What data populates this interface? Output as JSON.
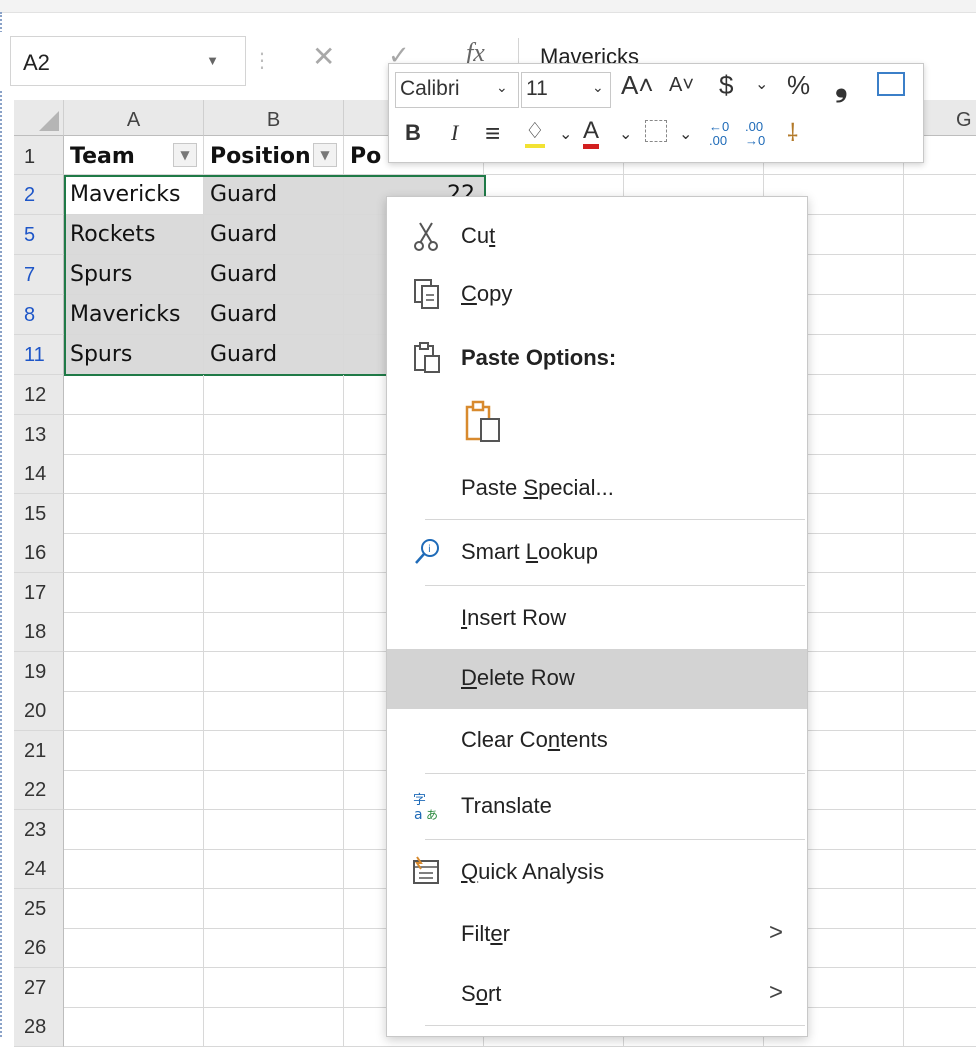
{
  "name_box": "A2",
  "formula": {
    "fx": "fx",
    "value": "Mavericks"
  },
  "columns": [
    "A",
    "B",
    "G"
  ],
  "header_row": {
    "num": "1",
    "team": "Team",
    "position": "Position",
    "points": "Po"
  },
  "data_rows": [
    {
      "num": "2",
      "team": "Mavericks",
      "position": "Guard",
      "points": "22"
    },
    {
      "num": "5",
      "team": "Rockets",
      "position": "Guard"
    },
    {
      "num": "7",
      "team": "Spurs",
      "position": "Guard"
    },
    {
      "num": "8",
      "team": "Mavericks",
      "position": "Guard"
    },
    {
      "num": "11",
      "team": "Spurs",
      "position": "Guard"
    }
  ],
  "empty_rows": [
    "12",
    "13",
    "14",
    "15",
    "16",
    "17",
    "18",
    "19",
    "20",
    "21",
    "22",
    "23",
    "24",
    "25",
    "26",
    "27",
    "28"
  ],
  "mini_toolbar": {
    "font": "Calibri",
    "size": "11",
    "bold": "B",
    "italic": "I",
    "currency": "$",
    "percent": "%"
  },
  "context_menu": {
    "cut": {
      "pre": "Cu",
      "key": "t",
      "post": ""
    },
    "copy": {
      "pre": "",
      "key": "C",
      "post": "opy"
    },
    "paste_options": "Paste Options:",
    "paste_special": {
      "pre": "Paste ",
      "key": "S",
      "post": "pecial..."
    },
    "smart_lookup": {
      "pre": "Smart ",
      "key": "L",
      "post": "ookup"
    },
    "insert_row": {
      "pre": "",
      "key": "I",
      "post": "nsert Row"
    },
    "delete_row": {
      "pre": "",
      "key": "D",
      "post": "elete Row"
    },
    "clear_contents": {
      "pre": "Clear Co",
      "key": "n",
      "post": "tents"
    },
    "translate": {
      "pre": "Translate",
      "key": "",
      "post": ""
    },
    "quick_analysis": {
      "pre": "",
      "key": "Q",
      "post": "uick Analysis"
    },
    "filter": {
      "pre": "Filt",
      "key": "e",
      "post": "r"
    },
    "sort": {
      "pre": "S",
      "key": "o",
      "post": "rt"
    },
    "submenu_arrow": ">"
  },
  "colors": {
    "selection_border": "#1f7a47",
    "row_number_blue": "#1e56c8",
    "paste_orange": "#d88a2e",
    "highlight": "#d3d3d3"
  }
}
